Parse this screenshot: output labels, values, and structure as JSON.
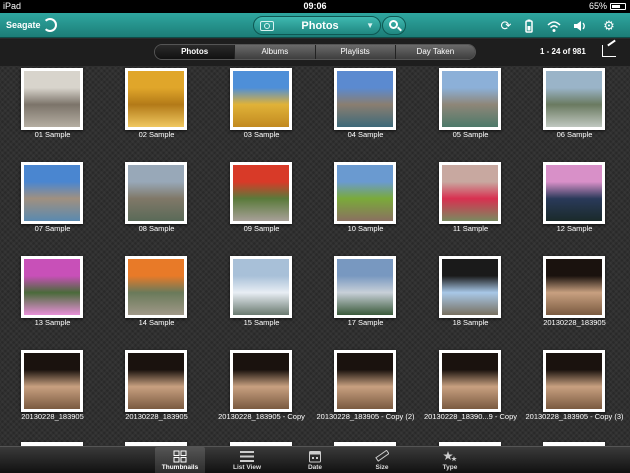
{
  "status_bar": {
    "device": "iPad",
    "time": "09:06",
    "battery": "65%"
  },
  "toolbar": {
    "logo": "Seagate",
    "title": "Photos"
  },
  "segments": [
    {
      "label": "Photos",
      "active": true
    },
    {
      "label": "Albums",
      "active": false
    },
    {
      "label": "Playlists",
      "active": false
    },
    {
      "label": "Day Taken",
      "active": false
    }
  ],
  "count_label": "1 - 24 of 981",
  "photos": [
    {
      "label": "01 Sample",
      "colors": [
        "#d8d4cc",
        "#7c746a",
        "#b5aea2"
      ]
    },
    {
      "label": "02 Sample",
      "colors": [
        "#e0a62a",
        "#b37a18",
        "#f0c860"
      ]
    },
    {
      "label": "03 Sample",
      "colors": [
        "#4e8fd8",
        "#e0b238",
        "#c28a20"
      ]
    },
    {
      "label": "04 Sample",
      "colors": [
        "#5b8ad0",
        "#8a7e70",
        "#3d6a7a"
      ]
    },
    {
      "label": "05 Sample",
      "colors": [
        "#8cb0d8",
        "#8e8678",
        "#4d7a6a"
      ]
    },
    {
      "label": "06 Sample",
      "colors": [
        "#9ab4c8",
        "#6a7a60",
        "#c0c8c0"
      ]
    },
    {
      "label": "07 Sample",
      "colors": [
        "#4a86d0",
        "#a09080",
        "#5a8ab0"
      ]
    },
    {
      "label": "08 Sample",
      "colors": [
        "#98a8b8",
        "#807868",
        "#5a6a58"
      ]
    },
    {
      "label": "09 Sample",
      "colors": [
        "#d83a28",
        "#5a7a3a",
        "#a8a098"
      ]
    },
    {
      "label": "10 Sample",
      "colors": [
        "#6a9ad0",
        "#7aaa3a",
        "#8a7060"
      ]
    },
    {
      "label": "11 Sample",
      "colors": [
        "#c8a8a0",
        "#d83050",
        "#7a8a60"
      ]
    },
    {
      "label": "12 Sample",
      "colors": [
        "#d890c8",
        "#2a3a5a",
        "#1a2a2a"
      ]
    },
    {
      "label": "13 Sample",
      "colors": [
        "#c850b8",
        "#4a6a3a",
        "#e890d8"
      ]
    },
    {
      "label": "14 Sample",
      "colors": [
        "#e87a28",
        "#6a7a5a",
        "#a09888"
      ]
    },
    {
      "label": "15 Sample",
      "colors": [
        "#a8c0d8",
        "#e8eef4",
        "#6a7a70"
      ]
    },
    {
      "label": "17 Sample",
      "colors": [
        "#7898c0",
        "#c8d0d8",
        "#3a5a3a"
      ]
    },
    {
      "label": "18 Sample",
      "colors": [
        "#1a1a1a",
        "#a8c8e8",
        "#787060"
      ]
    },
    {
      "label": "20130228_183905",
      "colors": [
        "#1a120e",
        "#c8a080",
        "#7a5a40"
      ]
    },
    {
      "label": "20130228_183905",
      "colors": [
        "#1a120e",
        "#c8a080",
        "#7a5a40"
      ]
    },
    {
      "label": "20130228_183905",
      "colors": [
        "#1a120e",
        "#c8a080",
        "#7a5a40"
      ]
    },
    {
      "label": "20130228_183905 - Copy",
      "colors": [
        "#1a120e",
        "#c8a080",
        "#7a5a40"
      ]
    },
    {
      "label": "20130228_183905 - Copy (2)",
      "colors": [
        "#1a120e",
        "#c8a080",
        "#7a5a40"
      ]
    },
    {
      "label": "20130228_18390...9 - Copy",
      "colors": [
        "#1a120e",
        "#c8a080",
        "#7a5a40"
      ]
    },
    {
      "label": "20130228_183905 - Copy (3)",
      "colors": [
        "#1a120e",
        "#c8a080",
        "#7a5a40"
      ]
    }
  ],
  "tabs": [
    {
      "label": "Thumbnails",
      "icon": "grid-icon",
      "active": true
    },
    {
      "label": "List View",
      "icon": "list-icon",
      "active": false
    },
    {
      "label": "Date",
      "icon": "calendar-icon",
      "active": false
    },
    {
      "label": "Size",
      "icon": "ruler-icon",
      "active": false
    },
    {
      "label": "Type",
      "icon": "stars-icon",
      "active": false
    }
  ]
}
